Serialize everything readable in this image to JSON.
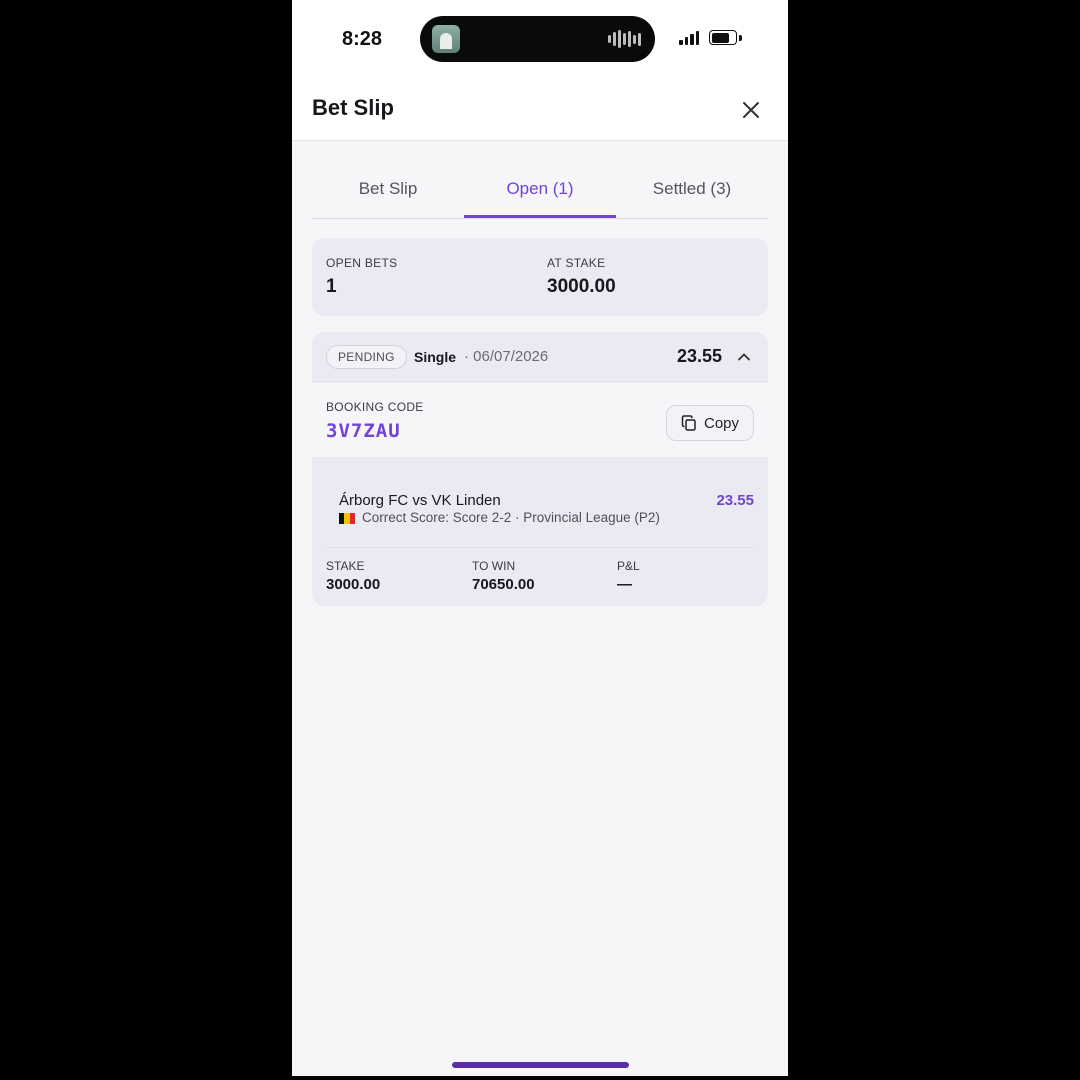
{
  "status_bar": {
    "time": "8:28"
  },
  "header": {
    "title": "Bet Slip"
  },
  "tabs": [
    {
      "label": "Bet Slip",
      "active": false
    },
    {
      "label": "Open (1)",
      "active": true
    },
    {
      "label": "Settled (3)",
      "active": false
    }
  ],
  "summary": {
    "open_bets_label": "OPEN BETS",
    "open_bets_value": "1",
    "at_stake_label": "AT STAKE",
    "at_stake_value": "3000.00"
  },
  "bet": {
    "status": "PENDING",
    "type": "Single",
    "date": "· 06/07/2026",
    "total_odds": "23.55",
    "booking_code_label": "BOOKING CODE",
    "booking_code": "3V7ZAU",
    "copy_label": "Copy",
    "selection": {
      "match": "Árborg FC vs VK Linden",
      "market": "Correct Score: Score 2-2 · Provincial League (P2)",
      "odds": "23.55"
    },
    "stake_label": "STAKE",
    "stake_value": "3000.00",
    "to_win_label": "TO WIN",
    "to_win_value": "70650.00",
    "pnl_label": "P&L",
    "pnl_value": "—"
  },
  "colors": {
    "accent": "#7244d6",
    "card_bg": "#ebe9f2",
    "page_bg": "#f6f5f8"
  }
}
